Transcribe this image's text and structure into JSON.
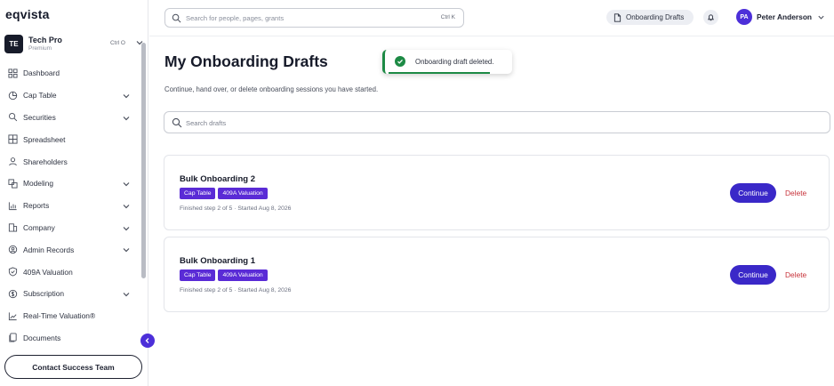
{
  "app": {
    "logo": "eqvista"
  },
  "org": {
    "initials": "TE",
    "name": "Tech Pro",
    "plan": "Premium",
    "shortcut": "Ctrl O"
  },
  "sidebar": {
    "items": [
      {
        "label": "Dashboard",
        "icon": "dashboard-icon",
        "has_chevron": false
      },
      {
        "label": "Cap Table",
        "icon": "pie-chart-icon",
        "has_chevron": true
      },
      {
        "label": "Securities",
        "icon": "securities-icon",
        "has_chevron": true
      },
      {
        "label": "Spreadsheet",
        "icon": "spreadsheet-icon",
        "has_chevron": false
      },
      {
        "label": "Shareholders",
        "icon": "users-icon",
        "has_chevron": false
      },
      {
        "label": "Modeling",
        "icon": "modeling-icon",
        "has_chevron": true
      },
      {
        "label": "Reports",
        "icon": "reports-icon",
        "has_chevron": true
      },
      {
        "label": "Company",
        "icon": "company-icon",
        "has_chevron": true
      },
      {
        "label": "Admin Records",
        "icon": "admin-records-icon",
        "has_chevron": true
      },
      {
        "label": "409A Valuation",
        "icon": "shield-check-icon",
        "has_chevron": false
      },
      {
        "label": "Subscription",
        "icon": "subscription-icon",
        "has_chevron": true
      },
      {
        "label": "Real-Time Valuation®",
        "icon": "trend-line-icon",
        "has_chevron": false
      },
      {
        "label": "Documents",
        "icon": "documents-icon",
        "has_chevron": false
      }
    ],
    "contact_label": "Contact Success Team"
  },
  "header": {
    "search_placeholder": "Search for people, pages, grants",
    "search_shortcut": "Ctrl K",
    "drafts_label": "Onboarding Drafts",
    "user": {
      "initials": "PA",
      "name": "Peter Anderson"
    }
  },
  "main": {
    "title": "My Onboarding Drafts",
    "subtitle": "Continue, hand over, or delete onboarding sessions you have started.",
    "search_placeholder": "Search drafts",
    "toast": {
      "message": "Onboarding draft deleted.",
      "status": "success"
    },
    "drafts": [
      {
        "title": "Bulk Onboarding 2",
        "tags": [
          "Cap Table",
          "409A Valuation"
        ],
        "meta": "Finished step 2 of 5 · Started Aug 8, 2026",
        "continue_label": "Continue",
        "delete_label": "Delete"
      },
      {
        "title": "Bulk Onboarding 1",
        "tags": [
          "Cap Table",
          "409A Valuation"
        ],
        "meta": "Finished step 2 of 5 · Started Aug 8, 2026",
        "continue_label": "Continue",
        "delete_label": "Delete"
      }
    ]
  },
  "colors": {
    "accent": "#4c2fd9",
    "tag": "#5a2bd6",
    "continue": "#3a28c8",
    "delete": "#c7323a",
    "success": "#1d8a45"
  }
}
